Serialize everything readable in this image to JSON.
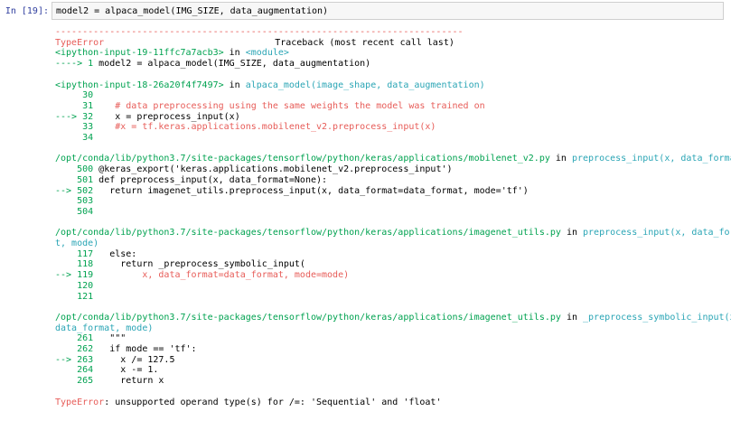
{
  "cell": {
    "prompt": "In [19]:",
    "code": "model2 = alpaca_model(IMG_SIZE, data_augmentation)"
  },
  "traceback": {
    "separator": "---------------------------------------------------------------------------",
    "header": {
      "error_type": "TypeError",
      "title": "Traceback (most recent call last)"
    },
    "frame1": {
      "file": "<ipython-input-19-11ffc7a7acb3>",
      "in": " in ",
      "func": "<module>",
      "arrow_line": {
        "arrow": "----> 1 ",
        "code": "model2 = alpaca_model(IMG_SIZE, data_augmentation)"
      }
    },
    "frame2": {
      "file": "<ipython-input-18-26a20f4f7497>",
      "in": " in ",
      "func": "alpaca_model(image_shape, data_augmentation)",
      "lines": [
        {
          "num": "     30",
          "code": ""
        },
        {
          "num": "     31",
          "code": "    # data preprocessing using the same weights the model was trained on"
        },
        {
          "num": "---> 32",
          "code": "    x = preprocess_input(x)"
        },
        {
          "num": "     33",
          "code": "    #x = tf.keras.applications.mobilenet_v2.preprocess_input(x)"
        },
        {
          "num": "     34",
          "code": ""
        }
      ]
    },
    "frame3": {
      "file": "/opt/conda/lib/python3.7/site-packages/tensorflow/python/keras/applications/mobilenet_v2.py",
      "in": " in ",
      "func": "preprocess_input(x, data_format)",
      "lines": [
        {
          "num": "    500",
          "code": " @keras_export('keras.applications.mobilenet_v2.preprocess_input')"
        },
        {
          "num": "    501",
          "code": " def preprocess_input(x, data_format=None):"
        },
        {
          "num": "--> 502",
          "code": "   return imagenet_utils.preprocess_input(x, data_format=data_format, mode='tf')"
        },
        {
          "num": "    503",
          "code": ""
        },
        {
          "num": "    504",
          "code": ""
        }
      ]
    },
    "frame4": {
      "file_line1": "/opt/conda/lib/python3.7/site-packages/tensorflow/python/keras/applications/imagenet_utils.py",
      "in": " in ",
      "func_line1": "preprocess_input(x, data_forma",
      "func_line2": "t, mode)",
      "lines": [
        {
          "num": "    117",
          "code": "   else:"
        },
        {
          "num": "    118",
          "code": "     return _preprocess_symbolic_input("
        },
        {
          "num": "--> 119",
          "code": "         x, data_format=data_format, mode=mode)"
        },
        {
          "num": "    120",
          "code": ""
        },
        {
          "num": "    121",
          "code": ""
        }
      ]
    },
    "frame5": {
      "file_line1": "/opt/conda/lib/python3.7/site-packages/tensorflow/python/keras/applications/imagenet_utils.py",
      "in": " in ",
      "func_line1": "_preprocess_symbolic_input(x,",
      "func_line2": "data_format, mode)",
      "lines": [
        {
          "num": "    261",
          "code": "   \"\"\""
        },
        {
          "num": "    262",
          "code": "   if mode == 'tf':"
        },
        {
          "num": "--> 263",
          "code": "     x /= 127.5"
        },
        {
          "num": "    264",
          "code": "     x -= 1."
        },
        {
          "num": "    265",
          "code": "     return x"
        }
      ]
    },
    "final": {
      "error_type": "TypeError",
      "message": ": unsupported operand type(s) for /=: 'Sequential' and 'float'"
    }
  }
}
